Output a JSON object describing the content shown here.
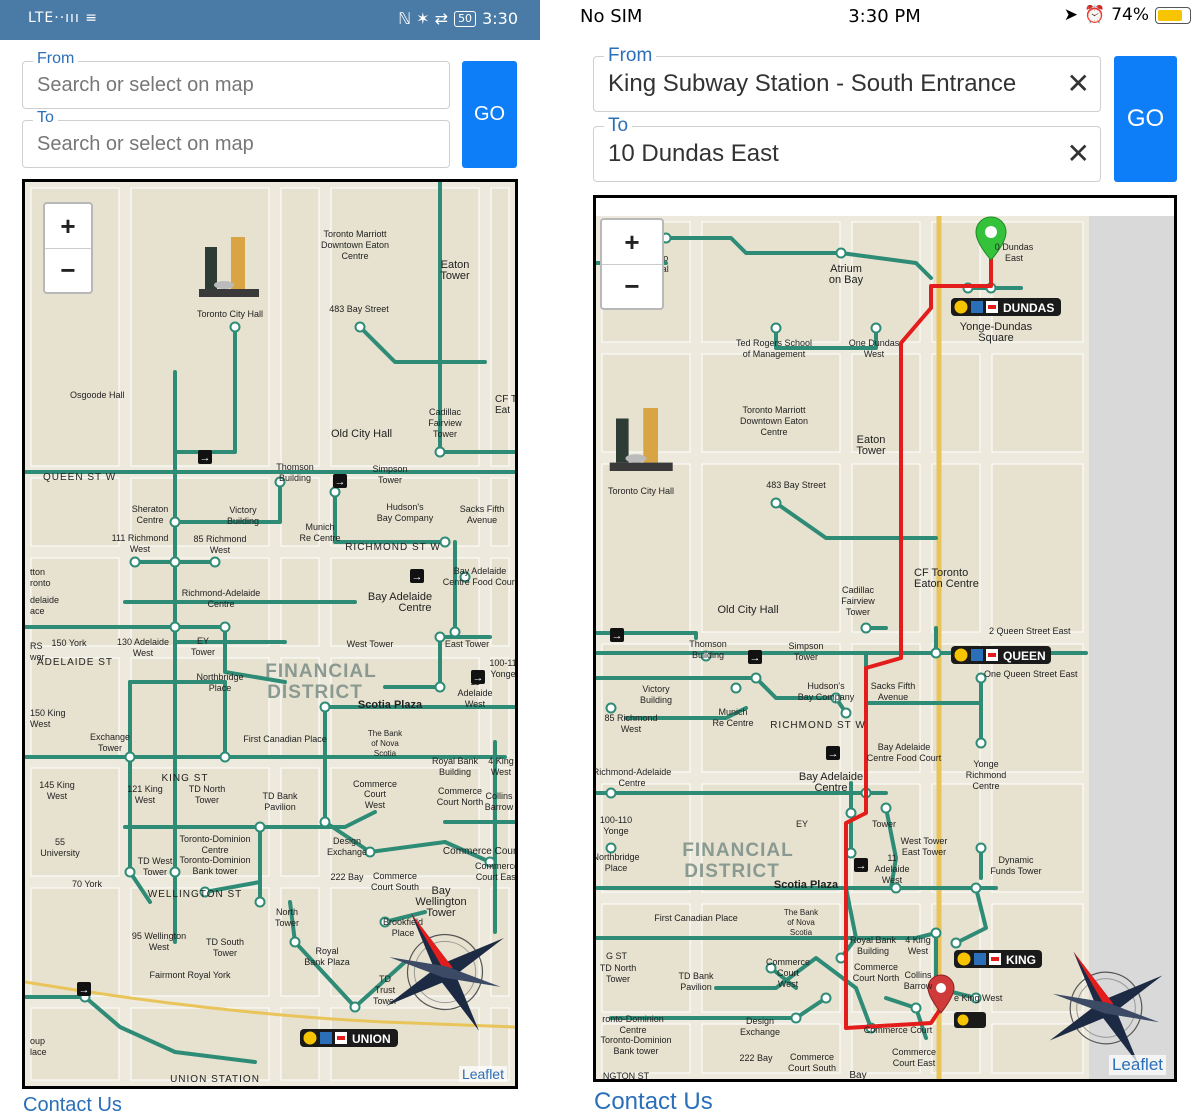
{
  "android": {
    "status": {
      "signal": "LTE··ııı ≡",
      "icons": "ℕ ✶ ⇄",
      "battery": "50",
      "time": "3:30"
    },
    "form": {
      "from_label": "From",
      "from_placeholder": "Search or select on map",
      "to_label": "To",
      "to_placeholder": "Search or select on map",
      "go_label": "GO"
    },
    "map": {
      "zoom_in": "+",
      "zoom_out": "−",
      "leaflet": "Leaflet",
      "district": [
        "FINANCIAL",
        "DISTRICT"
      ],
      "union_badge": "UNION",
      "labels": [
        "Toronto Marriott",
        "Downtown Eaton",
        "Centre",
        "Eaton",
        "Tower",
        "Toronto City Hall",
        "483 Bay Street",
        "Osgoode Hall",
        "Old City Hall",
        "Cadillac",
        "Fairview",
        "Tower",
        "QUEEN  ST W",
        "Thomson",
        "Building",
        "Simpson",
        "Tower",
        "Sheraton",
        "Centre",
        "Victory",
        "Building",
        "Hudson's",
        "Bay Company",
        "Sacks Fifth",
        "Avenue",
        "111 Richmond",
        "West",
        "85 Richmond",
        "West",
        "Munich",
        "Re Centre",
        "RICHMOND  ST W",
        "Bay Adelaide",
        "Centre Food Court",
        "Richmond-Adelaide",
        "Centre",
        "Bay Adelaide",
        "Centre",
        "150 York",
        "130 Adelaide",
        "West",
        "EY",
        "Tower",
        "West Tower",
        "East Tower",
        "ADELAIDE  ST",
        "Northbridge",
        "Place",
        "Scotia Plaza",
        "Exchange",
        "Tower",
        "First Canadian Place",
        "The Bank",
        "of Nova",
        "Scotia",
        "KING  ST",
        "145 King",
        "West",
        "121 King",
        "West",
        "TD North",
        "Tower",
        "TD Bank",
        "Pavilion",
        "Commerce",
        "Court",
        "West",
        "Royal Bank",
        "Building",
        "Toronto-Dominion",
        "Centre",
        "55",
        "University",
        "TD West",
        "Tower",
        "Design",
        "Exchange",
        "Commerce Court",
        "70 York",
        "222 Bay",
        "Commerce",
        "Court South",
        "WELLINGTON  ST",
        "Bay",
        "Wellington",
        "Tower",
        "95 Wellington",
        "West",
        "TD South",
        "Tower",
        "North",
        "Tower",
        "Royal",
        "Bank Plaza",
        "Fairmont Royal York",
        "UNION STATION",
        "CF T",
        "Eat",
        "100-11",
        "Yonge",
        "11",
        "Adelaide",
        "West",
        "4 King",
        "West",
        "Collins",
        "Barrow",
        "Commerce",
        "Court North",
        "150 King",
        "West",
        "tton",
        "ronto",
        "delaide",
        "ace",
        "RS",
        "wer",
        "oup",
        "lace",
        "Toronto-Dominion",
        "Bank tower",
        "Commerce",
        "Court East",
        "Brookfield",
        "Place",
        "TD",
        "Trust",
        "Tower"
      ]
    },
    "contact": "Contact Us"
  },
  "ios": {
    "status": {
      "carrier": "No SIM",
      "time": "3:30 PM",
      "battery": "74%"
    },
    "form": {
      "from_label": "From",
      "from_value": "King Subway Station - South Entrance",
      "to_label": "To",
      "to_value": "10 Dundas East",
      "clear": "✕",
      "go_label": "GO"
    },
    "map": {
      "zoom_in": "+",
      "zoom_out": "−",
      "leaflet": "Leaflet",
      "district": [
        "FINANCIAL",
        "DISTRICT"
      ],
      "badges": [
        "DUNDAS",
        "QUEEN",
        "KING"
      ],
      "labels": [
        "ronto",
        "minal",
        "Atrium",
        "on Bay",
        "0 Dundas",
        "East",
        "Yonge-Dundas",
        "Square",
        "Ted Rogers School",
        "of Management",
        "One Dundas",
        "West",
        "Toronto Marriott",
        "Downtown Eaton",
        "Centre",
        "Eaton",
        "Tower",
        "Toronto City Hall",
        "483 Bay Street",
        "CF Toronto",
        "Eaton Centre",
        "Cadillac",
        "Fairview",
        "Tower",
        "Old City Hall",
        "2 Queen Street East",
        "Thomson",
        "Building",
        "Simpson",
        "Tower",
        "One Queen Street East",
        "Victory",
        "Building",
        "Hudson's",
        "Bay Company",
        "Sacks Fifth",
        "Avenue",
        "85 Richmond",
        "West",
        "Munich",
        "Re Centre",
        "RICHMOND  ST W",
        "Yonge",
        "Richmond",
        "Centre",
        "Richmond-Adelaide",
        "Centre",
        "Bay Adelaide",
        "Centre Food Court",
        "Bay Adelaide",
        "Centre",
        "EY",
        "Tower",
        "West Tower",
        "East Tower",
        "100-110",
        "Yonge",
        "Northbridge",
        "Place",
        "11",
        "Adelaide",
        "West",
        "Dynamic",
        "Funds Tower",
        "Scotia Plaza",
        "First Canadian Place",
        "The Bank",
        "of Nova",
        "Scotia",
        "Royal Bank",
        "Building",
        "4 King",
        "West",
        "G ST",
        "TD North",
        "Tower",
        "TD Bank",
        "Pavilion",
        "Commerce",
        "Court",
        "West",
        "Commerce",
        "Court North",
        "Collins",
        "Barrow",
        "e King West",
        "ronto-Dominion",
        "Centre",
        "Design",
        "Exchange",
        "Commerce Court",
        "Toronto-Dominion",
        "Bank tower",
        "222 Bay",
        "Commerce",
        "Court South",
        "Commerce",
        "Court East",
        "Bay",
        "NGTON ST"
      ]
    },
    "contact": "Contact Us"
  },
  "colors": {
    "android_bar": "#4a7aa6",
    "go_button": "#0d7ef7",
    "link": "#2a6fb8",
    "route": "#e31c1c",
    "path_green": "#2e8b76",
    "map_bg": "#ede9dc",
    "yonge_line": "#e8c45a"
  },
  "icons": [
    "lte-signal-icon",
    "wifi-icon",
    "nfc-icon",
    "bluetooth-icon",
    "vibrate-icon",
    "battery-icon",
    "lock-rotation-icon",
    "location-icon",
    "alarm-icon",
    "clear-icon",
    "zoom-in-icon",
    "zoom-out-icon",
    "compass-rose-icon",
    "start-pin-icon",
    "destination-pin-icon",
    "subway-icon",
    "wheelchair-icon"
  ]
}
